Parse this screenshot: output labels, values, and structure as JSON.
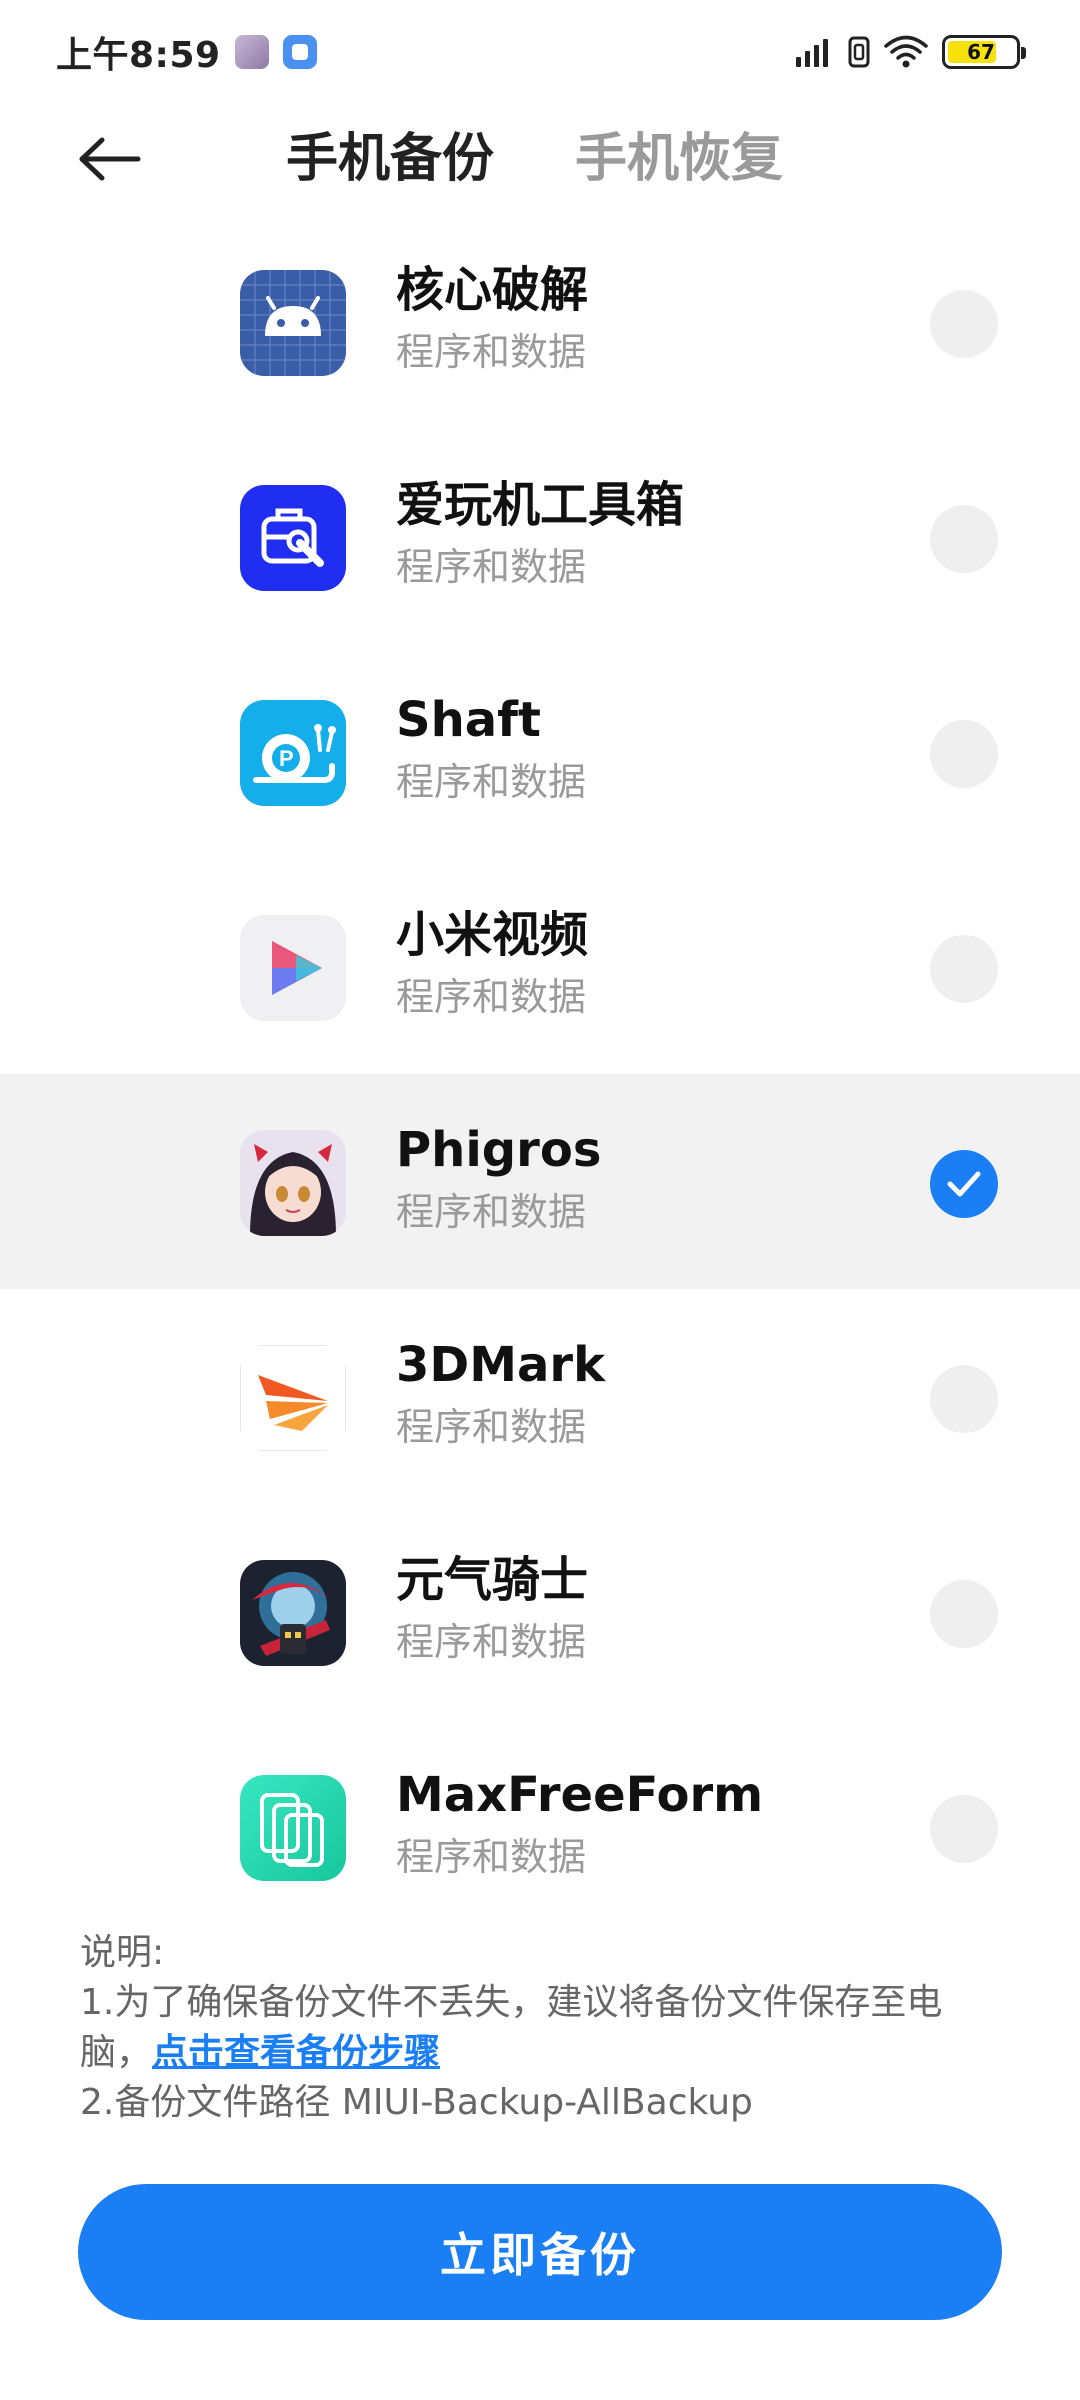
{
  "status_bar": {
    "time": "上午8:59",
    "battery": "67",
    "icons": [
      "avatar-icon",
      "app-notification-icon",
      "signal-icon",
      "sim-icon",
      "wifi-icon",
      "battery-icon"
    ]
  },
  "header": {
    "back_icon": "arrow-left-icon",
    "tabs": [
      {
        "label": "手机备份",
        "active": true
      },
      {
        "label": "手机恢复",
        "active": false
      }
    ]
  },
  "apps": [
    {
      "name": "核心破解",
      "sub": "程序和数据",
      "selected": false,
      "icon": "android-grid-icon"
    },
    {
      "name": "爱玩机工具箱",
      "sub": "程序和数据",
      "selected": false,
      "icon": "toolbox-icon"
    },
    {
      "name": "Shaft",
      "sub": "程序和数据",
      "selected": false,
      "icon": "snail-icon"
    },
    {
      "name": "小米视频",
      "sub": "程序和数据",
      "selected": false,
      "icon": "play-icon"
    },
    {
      "name": "Phigros",
      "sub": "程序和数据",
      "selected": true,
      "icon": "anime-girl-icon"
    },
    {
      "name": "3DMark",
      "sub": "程序和数据",
      "selected": false,
      "icon": "3dmark-icon"
    },
    {
      "name": "元气骑士",
      "sub": "程序和数据",
      "selected": false,
      "icon": "soul-knight-icon"
    },
    {
      "name": "MaxFreeForm",
      "sub": "程序和数据",
      "selected": false,
      "icon": "phone-frames-icon"
    }
  ],
  "note": {
    "title": "说明:",
    "line1": "1.为了确保备份文件不丢失，建议将备份文件保存至电",
    "line2_prefix": "脑，",
    "line2_link": "点击查看备份步骤",
    "line3": "2.备份文件路径 MIUI-Backup-AllBackup"
  },
  "action": {
    "label": "立即备份"
  },
  "colors": {
    "accent": "#1a7ff5",
    "selected_row": "#f2f2f2",
    "muted_text": "#9a9a9a",
    "radio_off": "#efefef",
    "battery_fill": "#f7e10b"
  }
}
